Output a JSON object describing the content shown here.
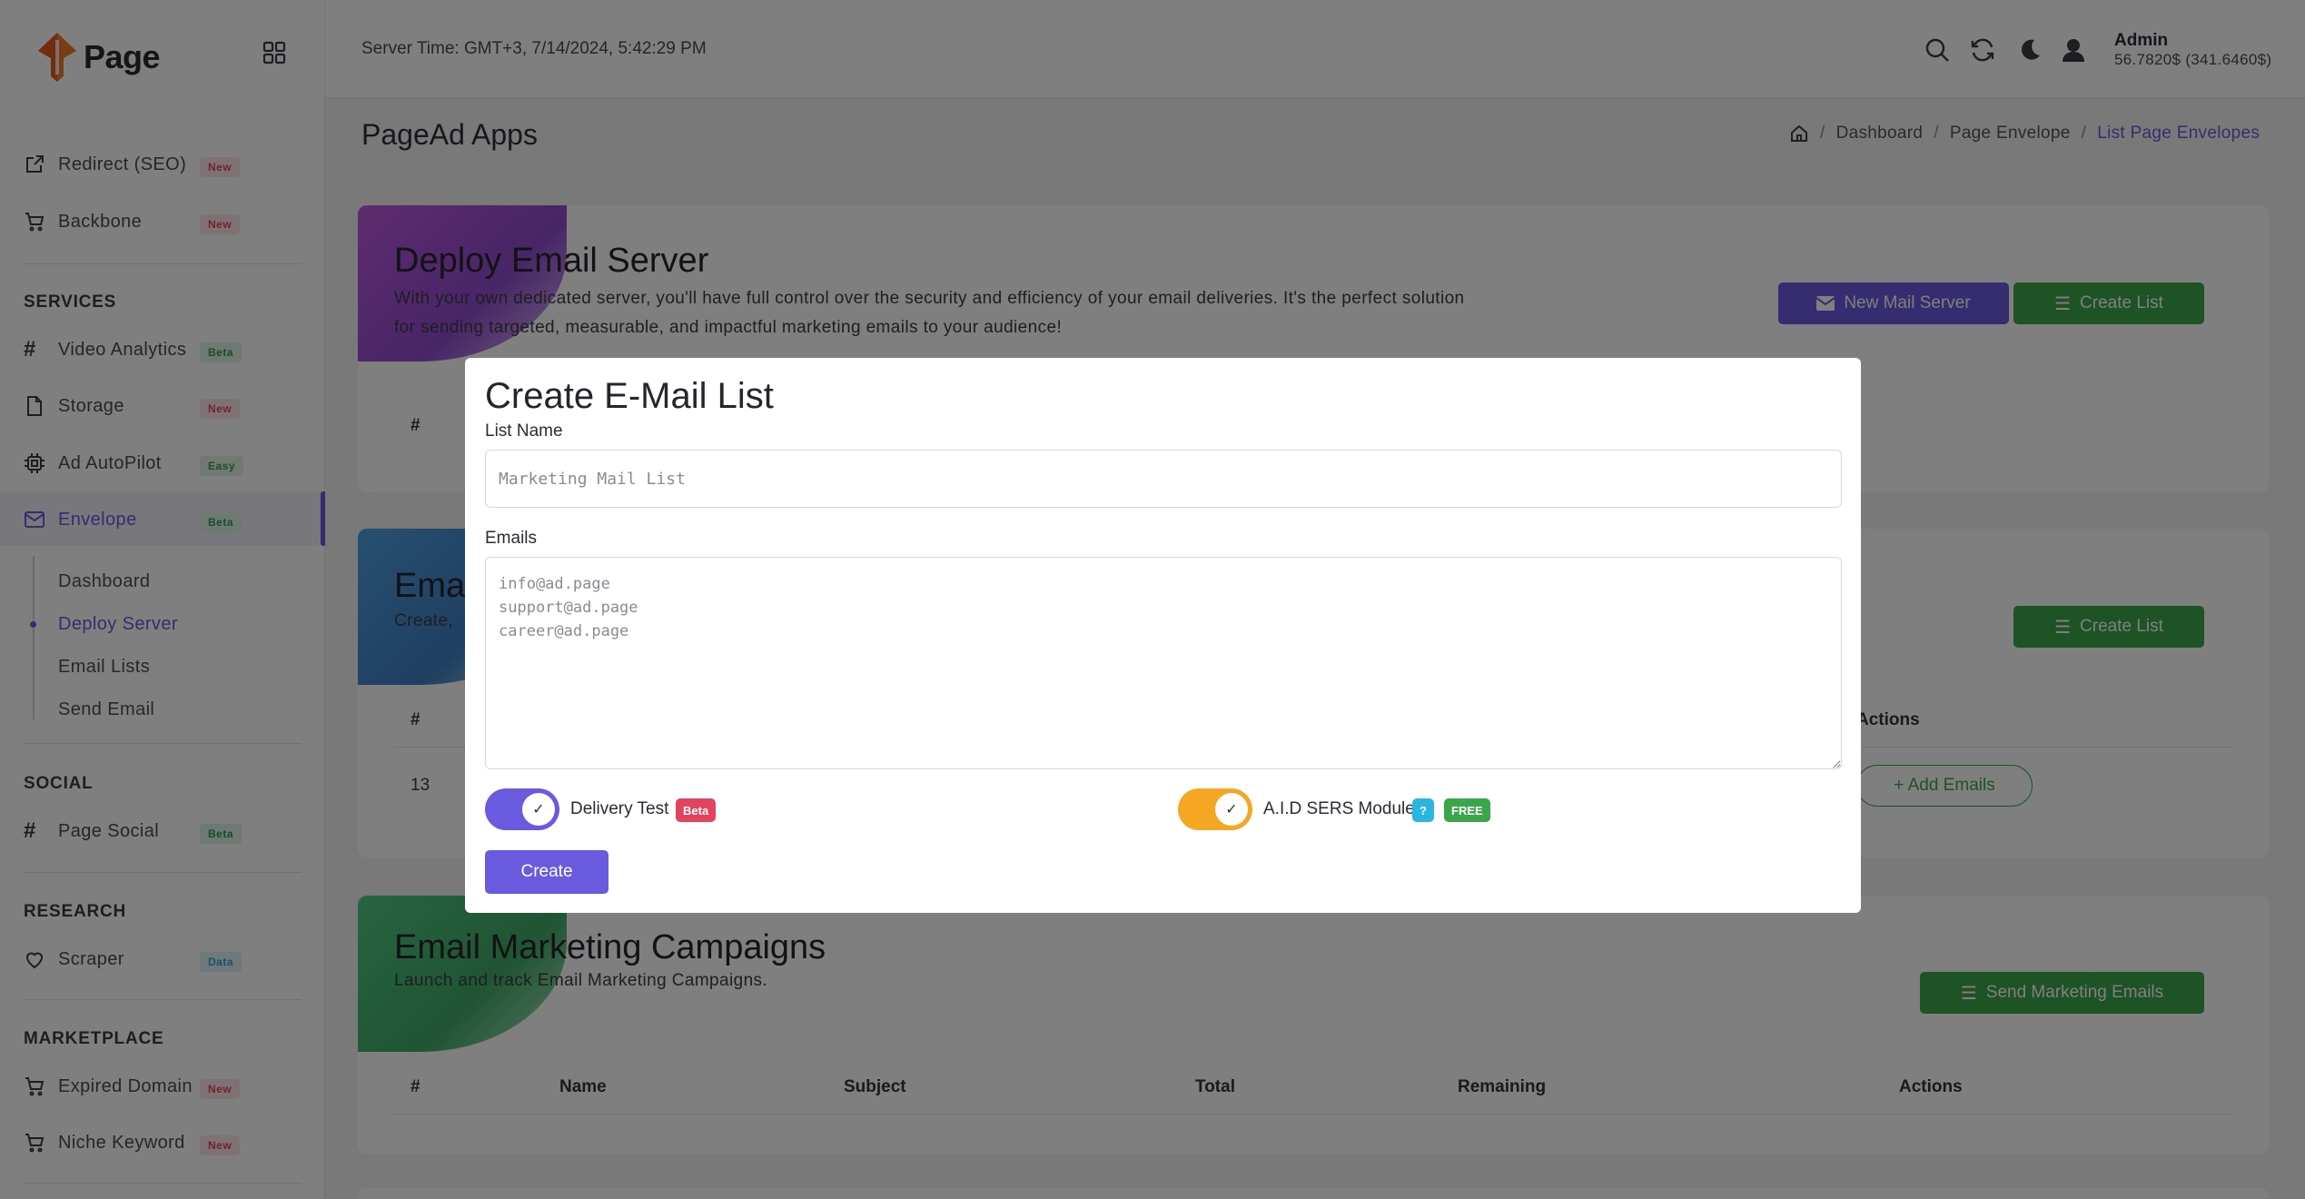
{
  "logo": {
    "text": "Page"
  },
  "topbar": {
    "server_time": "Server Time: GMT+3, 7/14/2024, 5:42:29 PM",
    "admin_name": "Admin",
    "admin_balance": "56.7820$ (341.6460$)"
  },
  "sidebar": {
    "top_items": [
      {
        "label": "Redirect (SEO)",
        "badge": "New",
        "icon": "external-link-icon"
      },
      {
        "label": "Backbone",
        "badge": "New",
        "icon": "cart-icon"
      }
    ],
    "sections": {
      "services": "SERVICES",
      "social": "SOCIAL",
      "research": "RESEARCH",
      "marketplace": "MARKETPLACE"
    },
    "services_items": [
      {
        "label": "Video Analytics",
        "badge": "Beta",
        "icon": "hash-icon"
      },
      {
        "label": "Storage",
        "badge": "New",
        "icon": "file-icon"
      },
      {
        "label": "Ad AutoPilot",
        "badge": "Easy",
        "icon": "cpu-icon"
      },
      {
        "label": "Envelope",
        "badge": "Beta",
        "icon": "mail-icon"
      }
    ],
    "envelope_sub": [
      "Dashboard",
      "Deploy Server",
      "Email Lists",
      "Send Email"
    ],
    "social_items": [
      {
        "label": "Page Social",
        "badge": "Beta",
        "icon": "hash-icon"
      }
    ],
    "research_items": [
      {
        "label": "Scraper",
        "badge": "Data",
        "icon": "heart-icon"
      }
    ],
    "marketplace_items": [
      {
        "label": "Expired Domain",
        "badge": "New",
        "icon": "cart-icon"
      },
      {
        "label": "Niche Keyword",
        "badge": "New",
        "icon": "cart-icon"
      }
    ]
  },
  "page": {
    "title": "PageAd Apps",
    "breadcrumb": [
      "Dashboard",
      "Page Envelope",
      "List Page Envelopes"
    ]
  },
  "cards": {
    "deploy": {
      "title": "Deploy Email Server",
      "desc_line1": "With your own dedicated server, you'll have full control over the security and efficiency of your email deliveries. It's the perfect solution",
      "desc_line2": "for sending targeted, measurable, and impactful marketing emails to your audience!",
      "btn_new": "New Mail Server",
      "btn_list": "Create List",
      "col_hash": "#"
    },
    "lists": {
      "title_partial": "Ema",
      "desc_partial": "Create, ",
      "btn_list": "Create List",
      "col_hash": "#",
      "col_actions": "Actions",
      "row_id": "13",
      "row_action": "+ Add Emails"
    },
    "campaigns": {
      "title": "Email Marketing Campaigns",
      "desc": "Launch and track Email Marketing Campaigns.",
      "btn_send": "Send Marketing Emails",
      "columns": [
        "#",
        "Name",
        "Subject",
        "Total",
        "Remaining",
        "Actions"
      ]
    }
  },
  "modal": {
    "title": "Create E-Mail List",
    "list_name_label": "List Name",
    "list_name_placeholder": "Marketing Mail List",
    "emails_label": "Emails",
    "emails_placeholder": "info@ad.page\nsupport@ad.page\ncareer@ad.page",
    "delivery_test_label": "Delivery Test",
    "delivery_badge": "Beta",
    "sers_label": "A.I.D SERS Module",
    "sers_help": "?",
    "sers_badge": "FREE",
    "create_button": "Create",
    "delivery_test_on": true,
    "sers_on": true
  },
  "colors": {
    "accent": "#6a5ae0",
    "green": "#3aa64a",
    "orange": "#f5a623",
    "badge_red": "#e4435f",
    "badge_cyan": "#29b6e0",
    "badge_green": "#3aa64a"
  }
}
